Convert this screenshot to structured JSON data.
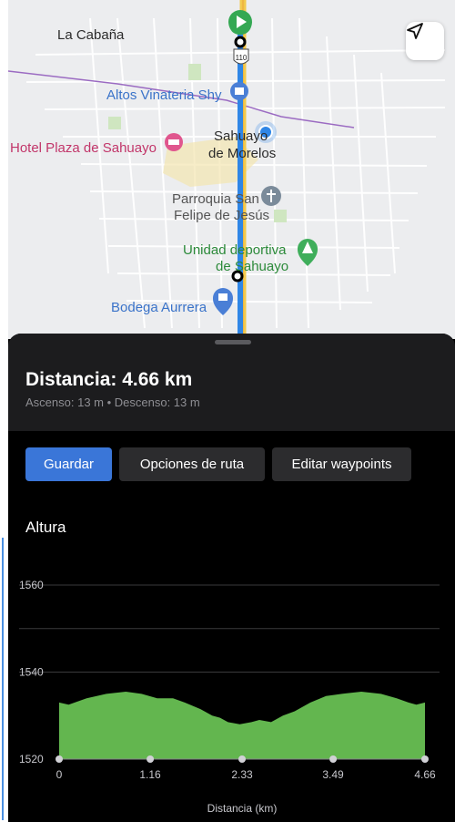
{
  "map": {
    "labels": {
      "la_cabana": "La Cabaña",
      "altos_vinateria": "Altos Vinateria Shy",
      "hotel_plaza": "Hotel Plaza de Sahuayo",
      "sahuayo_line1": "Sahuayo",
      "sahuayo_line2": "de Morelos",
      "parroquia_line1": "Parroquia San",
      "parroquia_line2": "Felipe de Jesús",
      "unidad_line1": "Unidad deportiva",
      "unidad_line2": "de Sahuayo",
      "bodega": "Bodega Aurrera",
      "road_shield": "110"
    },
    "colors": {
      "route": "#2f86e6",
      "road_yellow": "#f2c94c",
      "start_marker": "#34a853"
    }
  },
  "sheet": {
    "distance_title": "Distancia: 4.66 km",
    "elevation_summary": "Ascenso: 13 m • Descenso: 13 m",
    "buttons": {
      "save": "Guardar",
      "route_options": "Opciones de ruta",
      "edit_waypoints": "Editar waypoints"
    },
    "elevation_title": "Altura"
  },
  "chart_data": {
    "type": "area",
    "title": "Altura",
    "xlabel": "Distancia (km)",
    "ylabel": "",
    "xlim": [
      0,
      4.66
    ],
    "ylim": [
      1520,
      1560
    ],
    "x_ticks": [
      "0",
      "1.16",
      "2.33",
      "3.49",
      "4.66"
    ],
    "y_ticks": [
      "1560",
      "1540",
      "1520"
    ],
    "x": [
      0,
      0.12,
      0.35,
      0.6,
      0.85,
      1.05,
      1.25,
      1.45,
      1.6,
      1.8,
      1.95,
      2.05,
      2.15,
      2.3,
      2.45,
      2.55,
      2.7,
      2.85,
      3.0,
      3.2,
      3.4,
      3.6,
      3.85,
      4.1,
      4.3,
      4.45,
      4.55,
      4.66
    ],
    "values": [
      1533,
      1532.5,
      1534,
      1535,
      1535.5,
      1535,
      1534,
      1534,
      1533,
      1531.5,
      1530,
      1529.5,
      1528.5,
      1528,
      1528.5,
      1529,
      1528.5,
      1530,
      1531,
      1533,
      1534.5,
      1535,
      1535.5,
      1535,
      1534,
      1533,
      1532.5,
      1533
    ],
    "fill": "#63b64f",
    "grid": true
  }
}
